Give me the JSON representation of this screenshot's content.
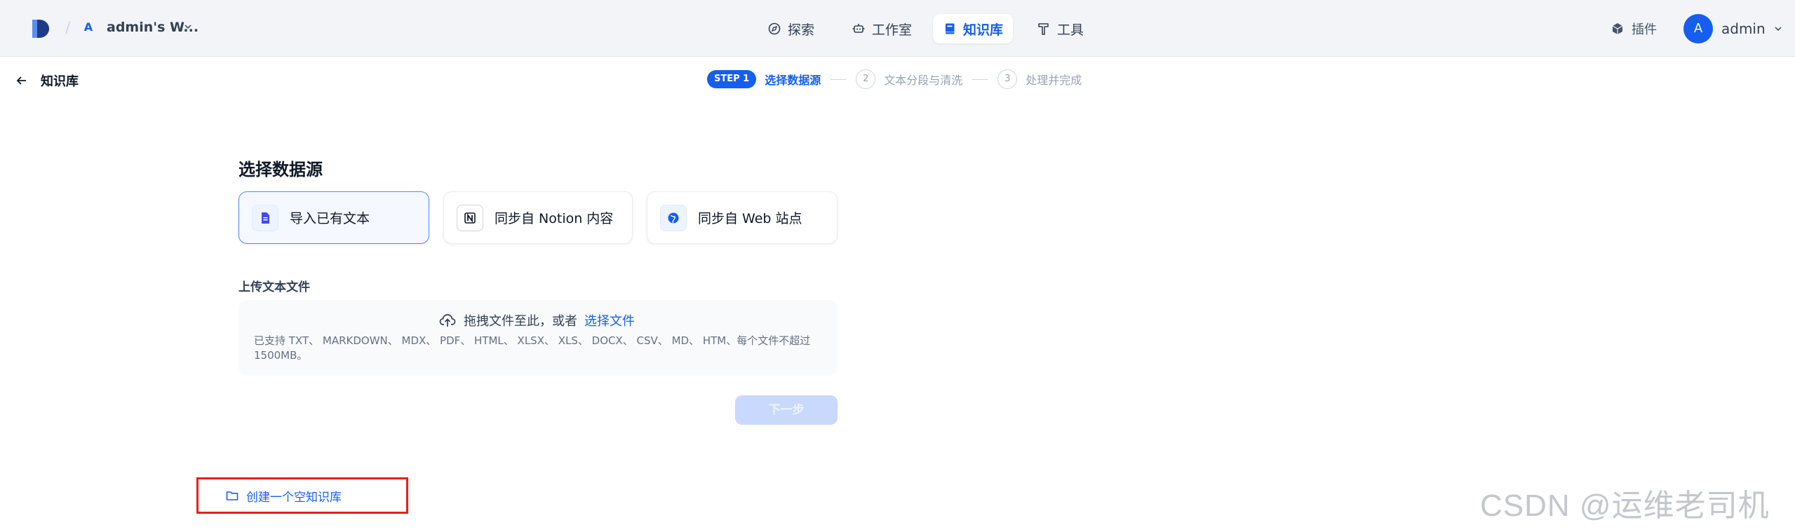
{
  "header": {
    "workspace_initial": "A",
    "workspace_name": "admin's W...",
    "nav": [
      {
        "label": "探索",
        "icon": "compass-icon"
      },
      {
        "label": "工作室",
        "icon": "robot-icon"
      },
      {
        "label": "知识库",
        "icon": "book-icon",
        "active": true
      },
      {
        "label": "工具",
        "icon": "hammer-icon"
      }
    ],
    "plugin_label": "插件",
    "user_initial": "A",
    "user_name": "admin"
  },
  "subheader": {
    "back_label": "知识库",
    "steps": {
      "step1_badge": "STEP 1",
      "step1_label": "选择数据源",
      "step2_num": "2",
      "step2_label": "文本分段与清洗",
      "step3_num": "3",
      "step3_label": "处理并完成"
    }
  },
  "main": {
    "title": "选择数据源",
    "sources": [
      {
        "label": "导入已有文本",
        "icon": "file-text-icon",
        "active": true
      },
      {
        "label": "同步自 Notion 内容",
        "icon": "notion-icon"
      },
      {
        "label": "同步自 Web 站点",
        "icon": "globe-icon"
      }
    ],
    "upload_title": "上传文本文件",
    "dropzone": {
      "text": "拖拽文件至此，或者",
      "link": "选择文件",
      "hint": "已支持 TXT、 MARKDOWN、 MDX、 PDF、 HTML、 XLSX、 XLS、 DOCX、 CSV、 MD、 HTM、每个文件不超过 1500MB。"
    },
    "next_label": "下一步",
    "create_empty_label": "创建一个空知识库"
  },
  "watermark": "CSDN @运维老司机",
  "colors": {
    "accent": "#155eef",
    "highlight_border": "#e8201c",
    "topbar_bg": "#f2f4f7"
  }
}
